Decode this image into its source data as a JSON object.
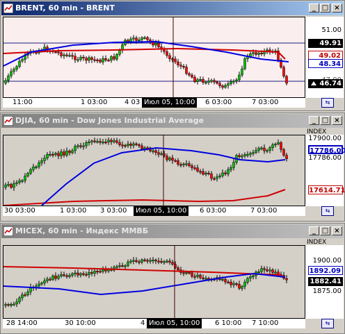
{
  "windows": [
    {
      "title": "BRENT, 60 min - BRENT",
      "active": true,
      "plot_bg": "#fbeeee",
      "y_labels": [
        "51.00"
      ],
      "x_labels": [
        "11:00",
        "1 03:00",
        "4 03",
        "6 03:00",
        "7 03:00"
      ],
      "crosshair_x_label": "Июл 05, 10:00",
      "index_label": "",
      "tags": [
        {
          "text": "49.91",
          "style": "black"
        },
        {
          "text": "49.02",
          "style": "red"
        },
        {
          "text": "48.34",
          "style": "blue"
        },
        {
          "text": "47.00",
          "style": "partial"
        },
        {
          "text": "46.74",
          "style": "last"
        }
      ]
    },
    {
      "title": "DJIA, 60 min - Dow Jones Industrial Average",
      "active": false,
      "plot_bg": "#ffffff",
      "y_labels": [
        "17900.00",
        "17786.00"
      ],
      "x_labels": [
        "30 03:00",
        "1 03:00",
        "3 03:00",
        "6 03:00",
        "7 03:00"
      ],
      "crosshair_x_label": "Июл 05, 10:00",
      "index_label": "INDEX",
      "tags": [
        {
          "text": "17786.00",
          "style": "blue-bold"
        },
        {
          "text": "17614.71",
          "style": "red"
        }
      ]
    },
    {
      "title": "MICEX, 60 min - Индекс ММВБ",
      "active": false,
      "plot_bg": "#ffffff",
      "y_labels": [
        "1900.00",
        "1875.00"
      ],
      "x_labels": [
        "28 14:00",
        "30 10:00",
        "4",
        "6 10:00",
        "7 10:00"
      ],
      "crosshair_x_label": "Июл 05, 10:00",
      "index_label": "INDEX",
      "tags": [
        {
          "text": "1892.09",
          "style": "blue"
        },
        {
          "text": "1882.41",
          "style": "black"
        }
      ]
    }
  ],
  "colors": {
    "up_candle": "#00c000",
    "down_candle": "#ff0000",
    "ma_red": "#d00000",
    "ma_blue": "#0000e0",
    "hline": "#1a1a80",
    "crosshair": "#400000"
  }
}
